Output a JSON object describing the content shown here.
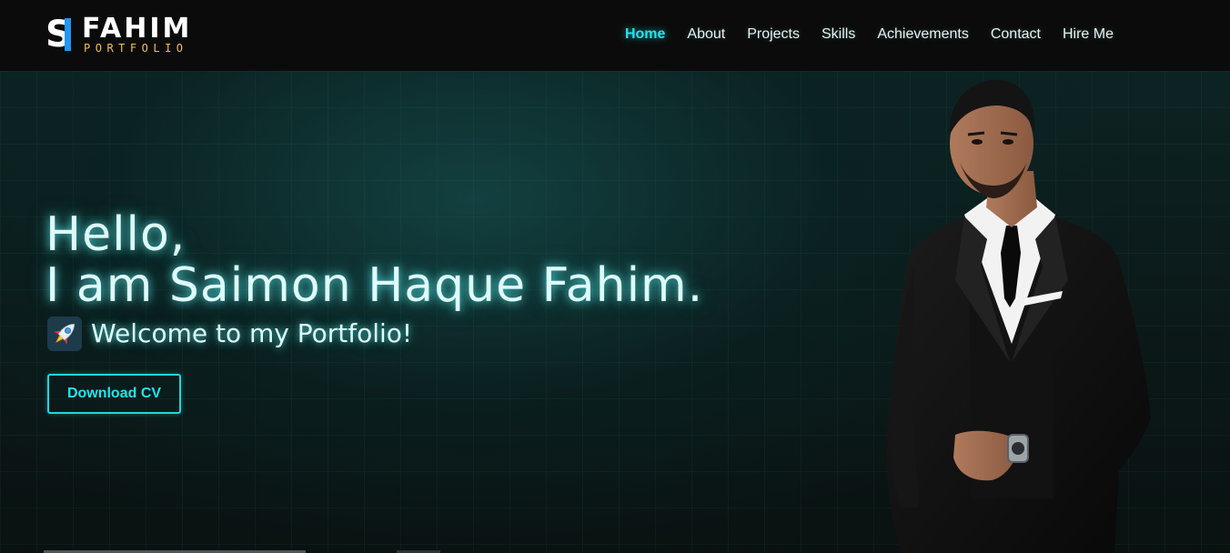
{
  "logo": {
    "mark": "S",
    "name": "FAHIM",
    "subtitle": "PORTFOLIO"
  },
  "nav": {
    "items": [
      {
        "label": "Home",
        "active": true
      },
      {
        "label": "About"
      },
      {
        "label": "Projects"
      },
      {
        "label": "Skills"
      },
      {
        "label": "Achievements"
      },
      {
        "label": "Contact"
      },
      {
        "label": "Hire Me"
      }
    ]
  },
  "hero": {
    "greeting": "Hello,",
    "intro": "I am Saimon Haque Fahim.",
    "welcome": "Welcome to my Portfolio!",
    "welcome_icon": "rocket-icon",
    "cv_button": "Download CV"
  },
  "colors": {
    "accent": "#1fe6ee",
    "logo_blue": "#2196f3",
    "logo_gold": "#f3c14b",
    "background": "#0b0b0b"
  }
}
